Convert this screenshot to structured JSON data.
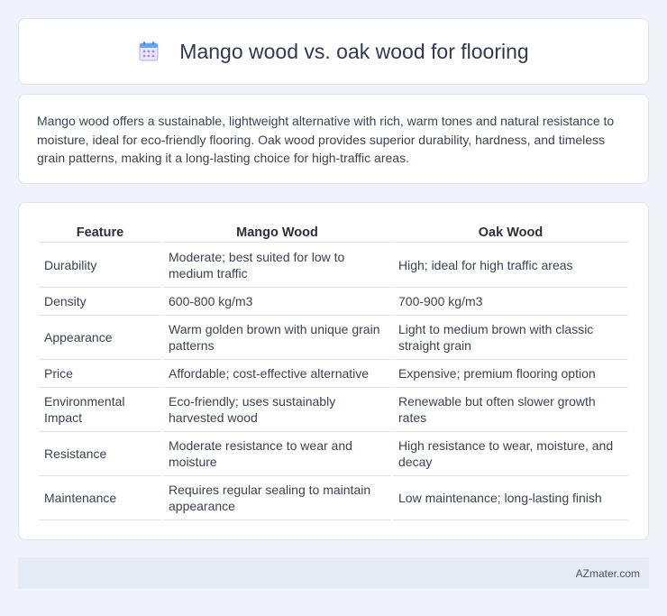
{
  "header": {
    "title": "Mango wood vs. oak wood for flooring",
    "icon": "calendar-icon"
  },
  "description": "Mango wood offers a sustainable, lightweight alternative with rich, warm tones and natural resistance to moisture, ideal for eco-friendly flooring. Oak wood provides superior durability, hardness, and timeless grain patterns, making it a long-lasting choice for high-traffic areas.",
  "table": {
    "headers": [
      "Feature",
      "Mango Wood",
      "Oak Wood"
    ],
    "rows": [
      [
        "Durability",
        "Moderate; best suited for low to medium traffic",
        "High; ideal for high traffic areas"
      ],
      [
        "Density",
        "600-800 kg/m3",
        "700-900 kg/m3"
      ],
      [
        "Appearance",
        "Warm golden brown with unique grain patterns",
        "Light to medium brown with classic straight grain"
      ],
      [
        "Price",
        "Affordable; cost-effective alternative",
        "Expensive; premium flooring option"
      ],
      [
        "Environmental Impact",
        "Eco-friendly; uses sustainably harvested wood",
        "Renewable but often slower growth rates"
      ],
      [
        "Resistance",
        "Moderate resistance to wear and moisture",
        "High resistance to wear, moisture, and decay"
      ],
      [
        "Maintenance",
        "Requires regular sealing to maintain appearance",
        "Low maintenance; long-lasting finish"
      ]
    ]
  },
  "footer": {
    "site": "AZmater.com"
  }
}
